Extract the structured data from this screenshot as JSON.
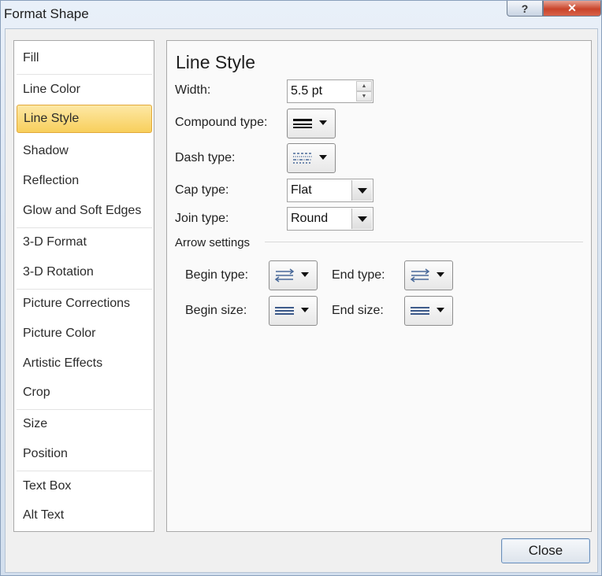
{
  "window": {
    "title": "Format Shape",
    "help_label": "?",
    "close_label": "✕"
  },
  "sidebar": {
    "items": [
      {
        "label": "Fill"
      },
      {
        "label": "Line Color"
      },
      {
        "label": "Line Style"
      },
      {
        "label": "Shadow"
      },
      {
        "label": "Reflection"
      },
      {
        "label": "Glow and Soft Edges"
      },
      {
        "label": "3-D Format"
      },
      {
        "label": "3-D Rotation"
      },
      {
        "label": "Picture Corrections"
      },
      {
        "label": "Picture Color"
      },
      {
        "label": "Artistic Effects"
      },
      {
        "label": "Crop"
      },
      {
        "label": "Size"
      },
      {
        "label": "Position"
      },
      {
        "label": "Text Box"
      },
      {
        "label": "Alt Text"
      }
    ],
    "selected": "Line Style"
  },
  "panel": {
    "title": "Line Style",
    "width": {
      "label": "Width:",
      "value": "5.5 pt"
    },
    "compound_type": {
      "label": "Compound type:",
      "icon": "compound-lines-icon"
    },
    "dash_type": {
      "label": "Dash type:",
      "icon": "dash-lines-icon"
    },
    "cap_type": {
      "label": "Cap type:",
      "value": "Flat"
    },
    "join_type": {
      "label": "Join type:",
      "value": "Round"
    },
    "arrow_settings": {
      "label": "Arrow settings",
      "begin_type": {
        "label": "Begin type:",
        "icon": "arrow-type-icon"
      },
      "end_type": {
        "label": "End type:",
        "icon": "arrow-type-icon"
      },
      "begin_size": {
        "label": "Begin size:",
        "icon": "arrow-size-icon"
      },
      "end_size": {
        "label": "End size:",
        "icon": "arrow-size-icon"
      }
    }
  },
  "footer": {
    "close_button": "Close"
  },
  "colors": {
    "selection": "#f8cf5c",
    "selection_border": "#e2a93b",
    "title_close": "#c9452b"
  }
}
